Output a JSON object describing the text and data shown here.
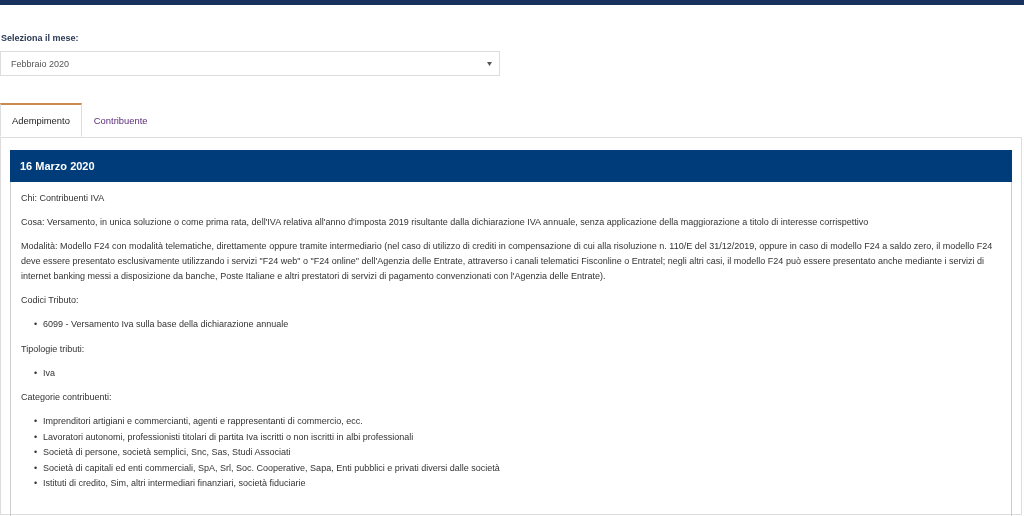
{
  "month_picker": {
    "label": "Seleziona il mese:",
    "value": "Febbraio 2020"
  },
  "tabs": [
    {
      "label": "Adempimento",
      "selected": true
    },
    {
      "label": "Contribuente",
      "selected": false
    }
  ],
  "deadline": {
    "title": "16 Marzo 2020",
    "paragraphs": [
      "Chi: Contribuenti IVA",
      "Cosa: Versamento, in unica soluzione o come prima rata, dell'IVA relativa all'anno d'imposta 2019 risultante dalla dichiarazione IVA annuale, senza applicazione della maggiorazione a titolo di interesse corrispettivo",
      "Modalità: Modello F24 con modalità telematiche, direttamente oppure tramite intermediario (nel caso di utilizzo di crediti in compensazione di cui alla risoluzione n. 110/E del 31/12/2019, oppure in caso di modello F24 a saldo zero, il modello F24 deve essere presentato esclusivamente utilizzando i servizi \"F24 web\" o \"F24 online\" dell'Agenzia delle Entrate, attraverso i canali telematici Fisconline o Entratel; negli altri casi, il modello F24 può essere presentato anche mediante i servizi di internet banking messi a disposizione da banche, Poste Italiane e altri prestatori di servizi di pagamento convenzionati con l'Agenzia delle Entrate)."
    ],
    "sections": [
      {
        "heading": "Codici Tributo:",
        "items": [
          {
            "bullet": "•",
            "text": "6099 - Versamento Iva sulla base della dichiarazione annuale"
          }
        ]
      },
      {
        "heading": "Tipologie tributi:",
        "items": [
          {
            "bullet": "•",
            "text": "Iva"
          }
        ]
      },
      {
        "heading": "Categorie contribuenti:",
        "items": [
          {
            "bullet": "•",
            "text": "Imprenditori artigiani e commercianti, agenti e rappresentanti di commercio, ecc."
          },
          {
            "bullet": "•",
            "text": "Lavoratori autonomi, professionisti titolari di partita Iva iscritti o non iscritti in albi professionali"
          },
          {
            "bullet": "•",
            "text": "Società di persone, società semplici, Snc, Sas, Studi Associati"
          },
          {
            "bullet": "•",
            "text": "Società di capitali ed enti commerciali, SpA, Srl, Soc. Cooperative, Sapa, Enti pubblici e privati diversi dalle società"
          },
          {
            "bullet": "•",
            "text": "Istituti di credito, Sim, altri intermediari finanziari, società fiduciarie"
          }
        ]
      }
    ]
  }
}
